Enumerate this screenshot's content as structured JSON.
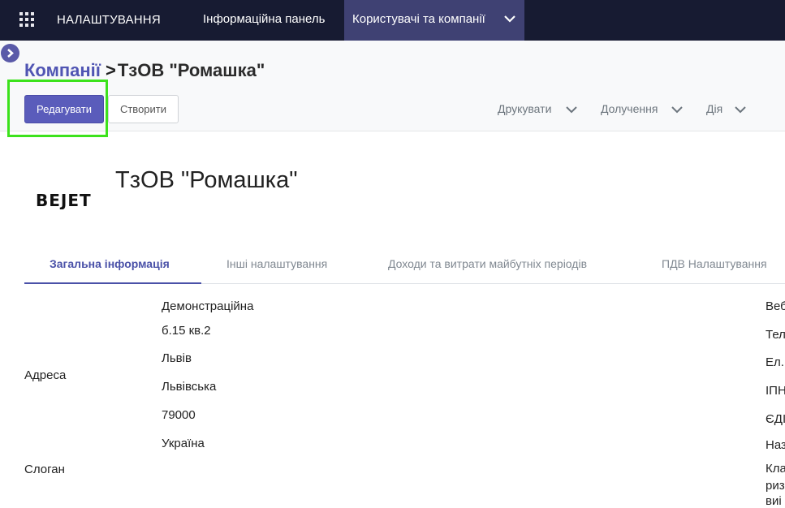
{
  "navbar": {
    "brand": "НАЛАШТУВАННЯ",
    "items": [
      {
        "label": "Інформаційна панель"
      },
      {
        "label": "Користувачі та компанії"
      }
    ]
  },
  "breadcrumb": {
    "parent": "Компанії",
    "separator": ">",
    "current": "ТзОВ \"Ромашка\""
  },
  "buttons": {
    "edit": "Редагувати",
    "create": "Створити"
  },
  "dropdowns": {
    "print": "Друкувати",
    "attachments": "Долучення",
    "action": "Дія"
  },
  "company": {
    "logo_text": "BEJET",
    "name": "ТзОВ \"Ромашка\""
  },
  "tabs": [
    {
      "label": "Загальна інформація",
      "active": true
    },
    {
      "label": "Інші налаштування",
      "active": false
    },
    {
      "label": "Доходи та витрати майбутніх періодів",
      "active": false
    },
    {
      "label": "ПДВ Налаштування",
      "active": false
    }
  ],
  "form": {
    "address_label": "Адреса",
    "address_lines": [
      "Демонстраційна",
      "б.15 кв.2",
      "Львів",
      "Львівська",
      "79000",
      "Україна"
    ],
    "slogan_label": "Слоган",
    "right_labels": [
      "Веб",
      "Тел",
      "Ел.",
      "ІПН",
      "ЄДІ",
      "Наз",
      "Кла",
      "риз",
      "виі"
    ]
  },
  "colors": {
    "navbar_bg": "#171b32",
    "navbar_active": "#3f4173",
    "primary": "#5a5cbb",
    "link": "#5055b3",
    "highlight": "#3ce21c"
  }
}
